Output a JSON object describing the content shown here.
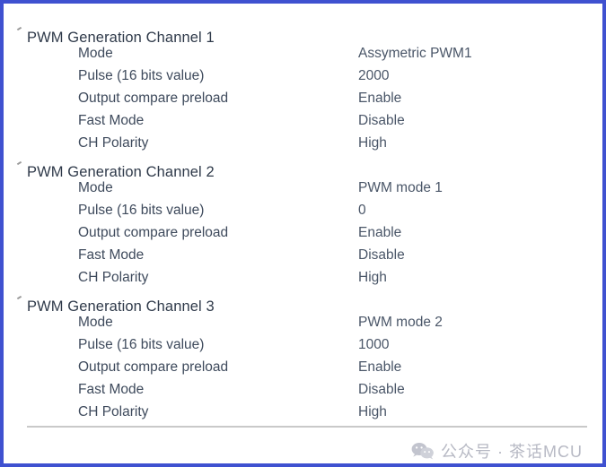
{
  "window": {
    "border_color": "#3f51d0",
    "background": "#ffffff"
  },
  "icons": {
    "bullet": "bullet-tick-icon",
    "wechat": "wechat-logo-icon"
  },
  "groups": [
    {
      "title": "PWM Generation Channel 1",
      "rows": [
        {
          "label": "Mode",
          "value": "Assymetric PWM1"
        },
        {
          "label": "Pulse (16 bits value)",
          "value": "2000"
        },
        {
          "label": "Output compare preload",
          "value": "Enable"
        },
        {
          "label": "Fast Mode",
          "value": "Disable"
        },
        {
          "label": "CH Polarity",
          "value": "High"
        }
      ]
    },
    {
      "title": "PWM Generation Channel 2",
      "rows": [
        {
          "label": "Mode",
          "value": "PWM mode 1"
        },
        {
          "label": "Pulse (16 bits value)",
          "value": "0"
        },
        {
          "label": "Output compare preload",
          "value": "Enable"
        },
        {
          "label": "Fast Mode",
          "value": "Disable"
        },
        {
          "label": "CH Polarity",
          "value": "High"
        }
      ]
    },
    {
      "title": "PWM Generation Channel 3",
      "rows": [
        {
          "label": "Mode",
          "value": "PWM mode 2"
        },
        {
          "label": "Pulse (16 bits value)",
          "value": "1000"
        },
        {
          "label": "Output compare preload",
          "value": "Enable"
        },
        {
          "label": "Fast Mode",
          "value": "Disable"
        },
        {
          "label": "CH Polarity",
          "value": "High"
        }
      ]
    }
  ],
  "footer": {
    "text": "公众号 · 茶话MCU",
    "text_color": "#b7b9c4"
  }
}
